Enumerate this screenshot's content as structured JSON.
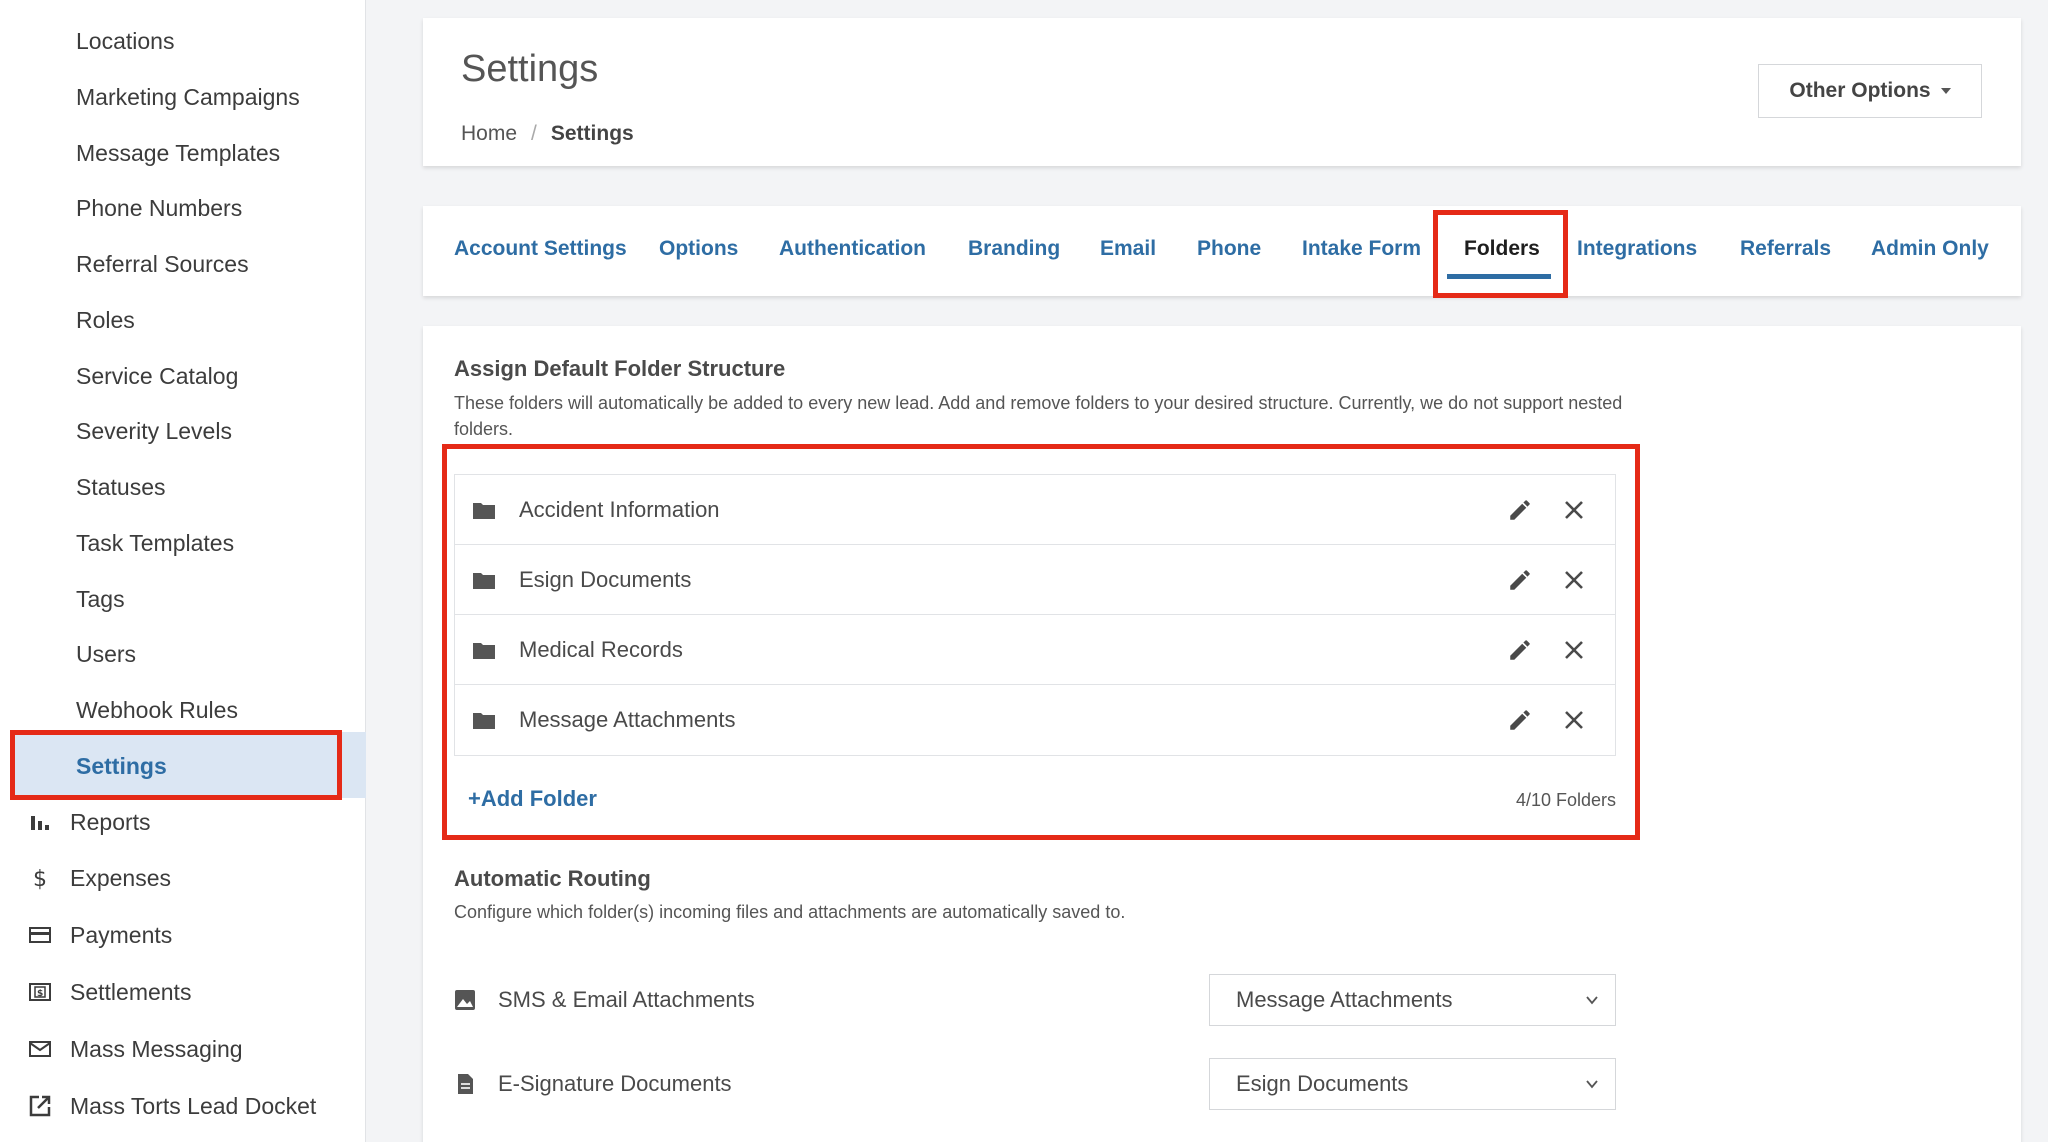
{
  "sidebar": {
    "sub_items": [
      "Locations",
      "Marketing Campaigns",
      "Message Templates",
      "Phone Numbers",
      "Referral Sources",
      "Roles",
      "Service Catalog",
      "Severity Levels",
      "Statuses",
      "Task Templates",
      "Tags",
      "Users",
      "Webhook Rules"
    ],
    "active_item": "Settings",
    "nav_items": [
      {
        "label": "Reports",
        "icon": "bar-chart-icon"
      },
      {
        "label": "Expenses",
        "icon": "dollar-icon"
      },
      {
        "label": "Payments",
        "icon": "credit-card-icon"
      },
      {
        "label": "Settlements",
        "icon": "cash-icon"
      },
      {
        "label": "Mass Messaging",
        "icon": "mail-icon"
      },
      {
        "label": "Mass Torts Lead Docket",
        "icon": "external-link-icon"
      }
    ]
  },
  "header": {
    "title": "Settings",
    "breadcrumb": {
      "home": "Home",
      "separator": "/",
      "current": "Settings"
    },
    "other_options_label": "Other Options"
  },
  "tabs": [
    {
      "label": "Account Settings"
    },
    {
      "label": "Options"
    },
    {
      "label": "Authentication"
    },
    {
      "label": "Branding"
    },
    {
      "label": "Email"
    },
    {
      "label": "Phone"
    },
    {
      "label": "Intake Form"
    },
    {
      "label": "Folders",
      "active": true
    },
    {
      "label": "Integrations"
    },
    {
      "label": "Referrals"
    },
    {
      "label": "Admin Only"
    }
  ],
  "folder_structure": {
    "title": "Assign Default Folder Structure",
    "description": "These folders will automatically be added to every new lead. Add and remove folders to your desired structure. Currently, we do not support nested folders.",
    "folders": [
      "Accident Information",
      "Esign Documents",
      "Medical Records",
      "Message Attachments"
    ],
    "add_label": "Add Folder",
    "count_label": "4/10 Folders"
  },
  "routing": {
    "title": "Automatic Routing",
    "description": "Configure which folder(s) incoming files and attachments are automatically saved to.",
    "rows": [
      {
        "label": "SMS & Email Attachments",
        "icon": "image-icon",
        "selected": "Message Attachments"
      },
      {
        "label": "E-Signature Documents",
        "icon": "document-icon",
        "selected": "Esign Documents"
      }
    ]
  },
  "colors": {
    "accent": "#2e6da4",
    "highlight": "#e52a17",
    "active_bg": "#dbe6f3"
  }
}
